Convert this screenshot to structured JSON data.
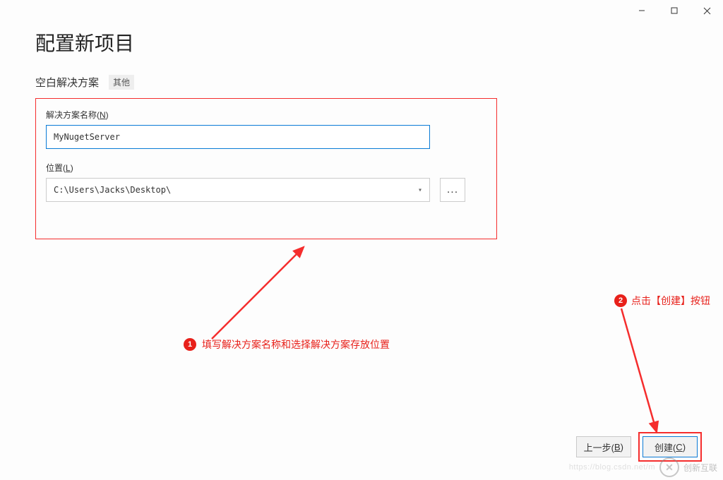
{
  "window": {
    "title": "配置新项目"
  },
  "subheader": {
    "template_name": "空白解决方案",
    "tag": "其他"
  },
  "form": {
    "solution_name": {
      "label_prefix": "解决方案名称(",
      "label_hotkey": "N",
      "label_suffix": ")",
      "value": "MyNugetServer"
    },
    "location": {
      "label_prefix": "位置(",
      "label_hotkey": "L",
      "label_suffix": ")",
      "value": "C:\\Users\\Jacks\\Desktop\\"
    },
    "browse_label": "..."
  },
  "annotations": {
    "a1": {
      "num": "1",
      "text": "填写解决方案名称和选择解决方案存放位置"
    },
    "a2": {
      "num": "2",
      "text": "点击【创建】按钮"
    }
  },
  "footer": {
    "back_prefix": "上一步(",
    "back_hotkey": "B",
    "back_suffix": ")",
    "create_prefix": "创建(",
    "create_hotkey": "C",
    "create_suffix": ")"
  },
  "watermark": {
    "url": "https://blog.csdn.net/m",
    "brand": "创新互联"
  }
}
